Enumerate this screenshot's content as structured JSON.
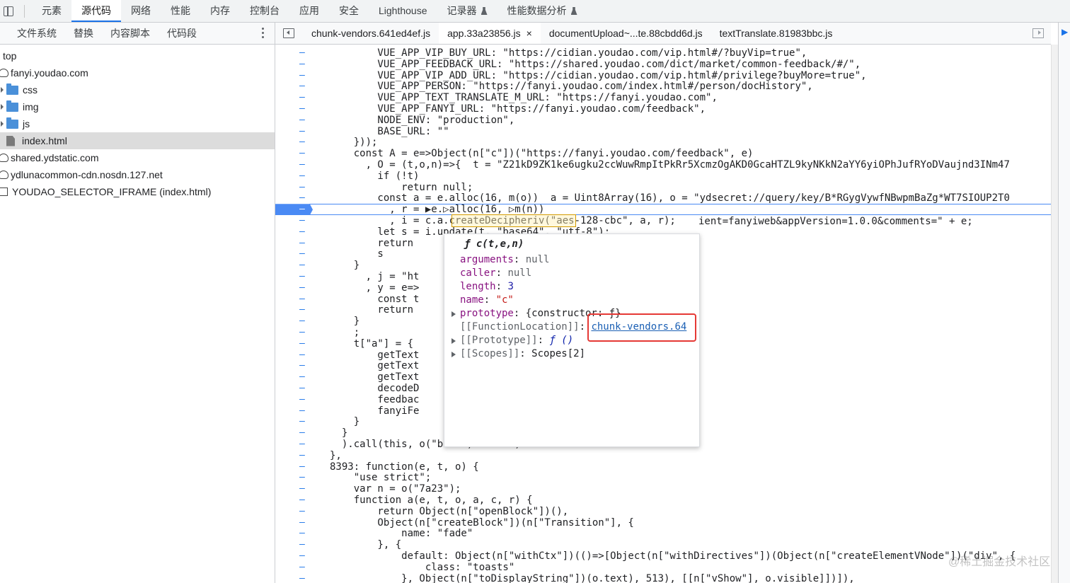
{
  "topbar": {
    "tabs": [
      {
        "label": "元素",
        "active": false
      },
      {
        "label": "源代码",
        "active": true
      },
      {
        "label": "网络",
        "active": false
      },
      {
        "label": "性能",
        "active": false
      },
      {
        "label": "内存",
        "active": false
      },
      {
        "label": "控制台",
        "active": false
      },
      {
        "label": "应用",
        "active": false
      },
      {
        "label": "安全",
        "active": false
      },
      {
        "label": "Lighthouse",
        "active": false
      },
      {
        "label": "记录器",
        "active": false
      },
      {
        "label": "性能数据分析",
        "active": false
      }
    ]
  },
  "sidebar": {
    "tabs": [
      "文件系统",
      "替换",
      "内容脚本",
      "代码段"
    ],
    "tree": [
      {
        "label": "top",
        "icon": "none"
      },
      {
        "label": "fanyi.youdao.com",
        "icon": "cloud-icon"
      },
      {
        "label": "css",
        "icon": "folder-icon"
      },
      {
        "label": "img",
        "icon": "folder-icon"
      },
      {
        "label": "js",
        "icon": "folder-icon"
      },
      {
        "label": "index.html",
        "icon": "file-icon",
        "selected": true
      },
      {
        "label": "shared.ydstatic.com",
        "icon": "cloud-icon"
      },
      {
        "label": "ydlunacommon-cdn.nosdn.127.net",
        "icon": "cloud-icon"
      },
      {
        "label": "YOUDAO_SELECTOR_IFRAME (index.html)",
        "icon": "frame-icon"
      }
    ]
  },
  "editor": {
    "tabs": [
      {
        "label": "chunk-vendors.641ed4ef.js",
        "active": false
      },
      {
        "label": "app.33a23856.js",
        "active": true,
        "closable": true,
        "close": "×"
      },
      {
        "label": "documentUpload~...te.88cbdd6d.js",
        "active": false
      },
      {
        "label": "textTranslate.81983bbc.js",
        "active": false
      }
    ],
    "lines": [
      "        VUE_APP_VIP_BUY_URL: \"https://cidian.youdao.com/vip.html#/?buyVip=true\",",
      "        VUE_APP_FEEDBACK_URL: \"https://shared.youdao.com/dict/market/common-feedback/#/\",",
      "        VUE_APP_VIP_ADD_URL: \"https://cidian.youdao.com/vip.html#/privilege?buyMore=true\",",
      "        VUE_APP_PERSON: \"https://fanyi.youdao.com/index.html#/person/docHistory\",",
      "        VUE_APP_TEXT_TRANSLATE_M_URL: \"https://fanyi.youdao.com\",",
      "        VUE_APP_FANYI_URL: \"https://fanyi.youdao.com/feedback\",",
      "        NODE_ENV: \"production\",",
      "        BASE_URL: \"\"",
      "    }));",
      "    const A = e=>Object(n[\"c\"])(\"https://fanyi.youdao.com/feedback\", e)",
      "      , O = (t,o,n)=>{  t = \"Z21kD9ZK1ke6ugku2ccWuwRmpItPkRr5XcmzOgAKD0GcaHTZL9kyNKkN2aYY6yiOPhJufRYoDVaujnd3INm47",
      "        if (!t)",
      "            return null;",
      "        const a = e.alloc(16, m(o))  a = Uint8Array(16), o = \"ydsecret://query/key/B*RGygVywfNBwpmBaZg*WT7SIOUP2T0",
      "          , r = ▶e.▷alloc(16, ▷m(n))",
      "          , i = c.a.createDecipheriv(\"aes-128-cbc\", a, r);",
      "        let s = i.update(t, \"base64\", \"utf-8\");",
      "        return",
      "        s",
      "    }",
      "      , j = \"ht",
      "      , y = e=>",
      "        const t",
      "        return",
      "    }",
      "    ;",
      "    t[\"a\"] = {",
      "        getText",
      "        getText",
      "        getText",
      "        decodeD",
      "        feedbac",
      "        fanyiFe",
      "    }",
      "  }",
      "  ).call(this, o(\"b639\").Buffer)",
      "},",
      "8393: function(e, t, o) {",
      "    \"use strict\";",
      "    var n = o(\"7a23\");",
      "    function a(e, t, o, a, c, r) {",
      "        return Object(n[\"openBlock\"])(),",
      "        Object(n[\"createBlock\"])(n[\"Transition\"], {",
      "            name: \"fade\"",
      "        }, {",
      "            default: Object(n[\"withCtx\"])(()=>[Object(n[\"withDirectives\"])(Object(n[\"createElementVNode\"])(\"div\", {",
      "                class: \"toasts\"",
      "            }, Object(n[\"toDisplayString\"])(o.text), 513), [[n[\"vShow\"], o.visible]])]),"
    ],
    "right_fragment": "ient=fanyiweb&appVersion=1.0.0&comments=\" + e;"
  },
  "tooltip": {
    "header": "ƒ c(t,e,n)",
    "arguments_key": "arguments",
    "arguments_val": "null",
    "caller_key": "caller",
    "caller_val": "null",
    "length_key": "length",
    "length_val": "3",
    "name_key": "name",
    "name_val": "\"c\"",
    "prototype_key": "prototype",
    "prototype_val": "{constructor: ƒ}",
    "function_location_key": "[[FunctionLocation]]",
    "function_location_val": "chunk-vendors.64",
    "proto_key": "[[Prototype]]",
    "proto_val": "ƒ ()",
    "scopes_key": "[[Scopes]]",
    "scopes_val": "Scopes[2]"
  },
  "watermark": "@稀土掘金技术社区",
  "colors": {
    "accent": "#1a73e8",
    "breakpoint": "#4a8af4",
    "highlight_outline": "#e53935"
  }
}
